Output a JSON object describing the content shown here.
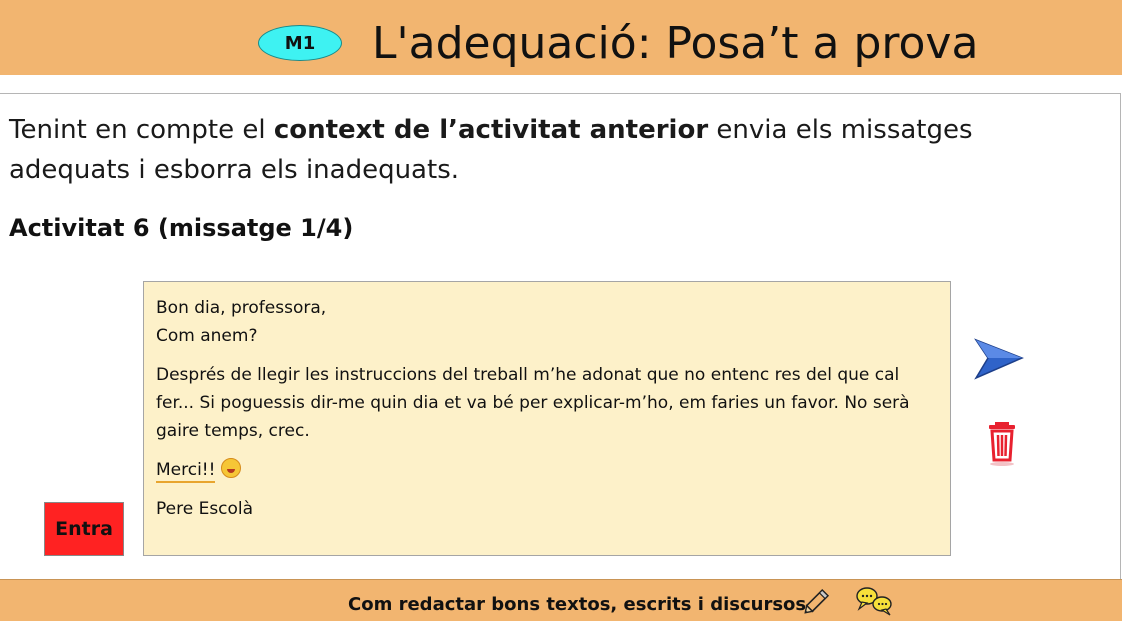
{
  "header": {
    "badge": "M1",
    "title": "L'adequació: Posa’t a prova"
  },
  "instructions": {
    "before": "Tenint en compte el ",
    "bold": "context de l’activitat anterior",
    "after": " envia els missatges adequats i esborra els inadequats."
  },
  "activity": {
    "title": "Activitat 6 (missatge 1/4)"
  },
  "message": {
    "line1": "Bon dia, professora,",
    "line2": "Com anem?",
    "body": "Després de llegir les instruccions del treball m’he adonat que no entenc res del que cal fer... Si poguessis dir-me quin dia et va bé per explicar-m’ho, em faries un favor. No serà gaire temps, crec.",
    "thanks": "Merci!!",
    "signature": "Pere Escolà"
  },
  "buttons": {
    "entra": "Entra"
  },
  "footer": {
    "text": "Com redactar bons textos, escrits i discursos"
  },
  "icons": {
    "send": "send-paper-plane-icon",
    "delete": "trash-icon",
    "pencil": "pencil-icon",
    "chat": "speech-bubbles-icon"
  },
  "colors": {
    "header_bg": "#f2b570",
    "badge_bg": "#3ef2f2",
    "message_bg": "#fdf1c9",
    "entra_bg": "#ff2222",
    "send_blue": "#2f63c9",
    "trash_red": "#e8212f"
  }
}
